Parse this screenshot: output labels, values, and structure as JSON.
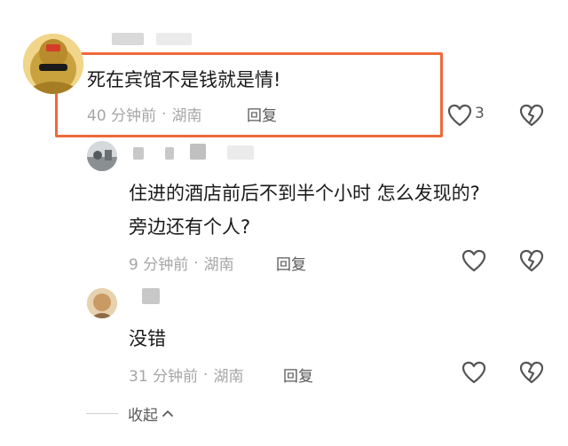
{
  "comments": [
    {
      "text": "死在宾馆不是钱就是情!",
      "time": "40 分钟前",
      "sep": "·",
      "location": "湖南",
      "reply_label": "回复",
      "like_count": "3"
    },
    {
      "text_line1": "住进的酒店前后不到半个小时 怎么发现的?",
      "text_line2": "旁边还有个人?",
      "time": "9 分钟前",
      "sep": "·",
      "location": "湖南",
      "reply_label": "回复"
    },
    {
      "text": "没错",
      "time": "31 分钟前",
      "sep": "·",
      "location": "湖南",
      "reply_label": "回复"
    }
  ],
  "collapse_label": "收起",
  "colors": {
    "highlight_border": "#ee6a3a",
    "meta_text": "#a6a6a6",
    "icon_stroke": "#555555"
  },
  "icons": [
    "heart-icon",
    "broken-heart-icon",
    "chevron-up-icon"
  ]
}
